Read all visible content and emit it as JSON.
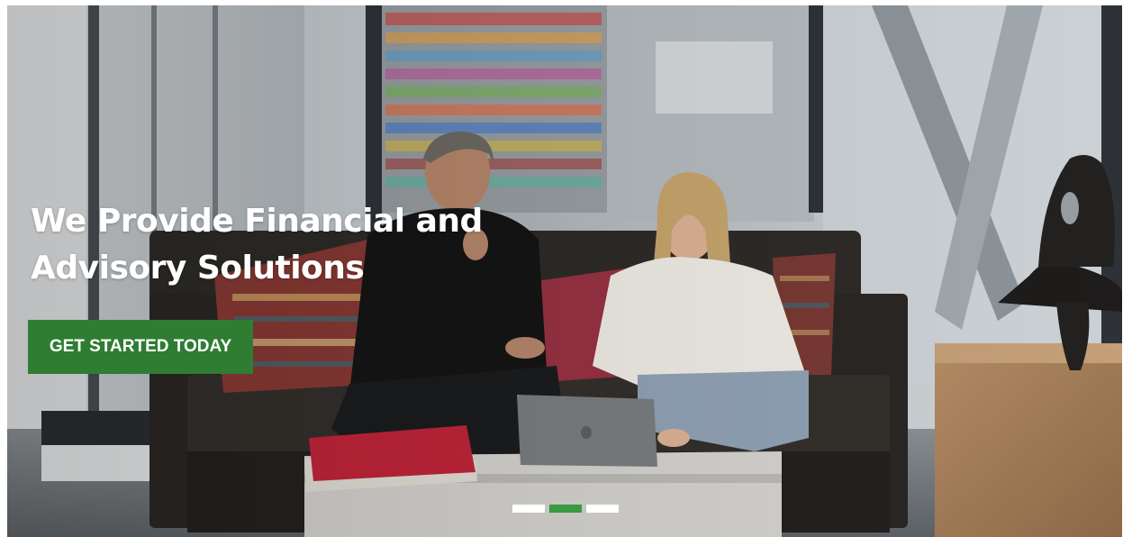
{
  "hero": {
    "title_line1": "We Provide Financial and",
    "title_line2": "Advisory Solutions",
    "cta_label": "GET STARTED TODAY",
    "image_alt": "Two professionals reviewing work on a laptop in an office lounge"
  },
  "slider": {
    "slide_count": 3,
    "active_index": 1
  },
  "colors": {
    "cta_background": "#2e7d32",
    "active_dot": "#3a9a3f",
    "inactive_dot": "#ffffff",
    "title_text": "#ffffff"
  }
}
